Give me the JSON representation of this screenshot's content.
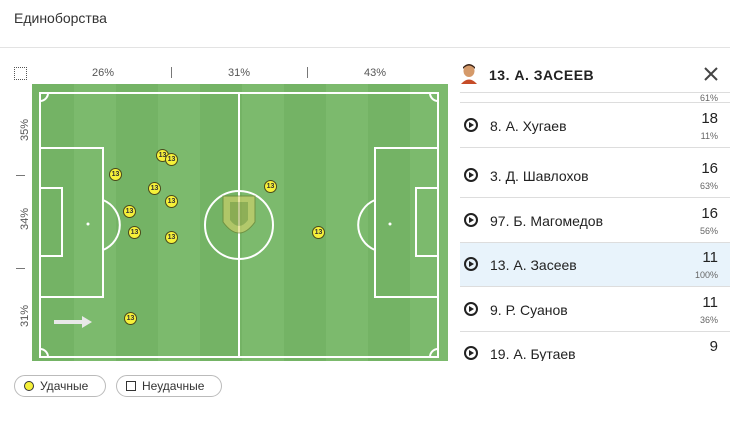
{
  "title": "Единоборства",
  "top_pcts": [
    "26%",
    "31%",
    "43%"
  ],
  "left_pcts": [
    "35%",
    "34%",
    "31%"
  ],
  "player_number": "13",
  "panel": {
    "player": "13. А. ЗАСЕЕВ",
    "partial_pct": "61%",
    "rows": [
      {
        "name": "8. А. Хугаев",
        "value": "18",
        "pct": "11%"
      },
      {
        "name": "3. Д. Шавлохов",
        "value": "16",
        "pct": "63%"
      },
      {
        "name": "97. Б. Магомедов",
        "value": "16",
        "pct": "56%"
      },
      {
        "name": "13. А. Засеев",
        "value": "11",
        "pct": "100%"
      },
      {
        "name": "9. Р. Суанов",
        "value": "11",
        "pct": "36%"
      },
      {
        "name": "19. А. Бутаев",
        "value": "9",
        "pct": ""
      }
    ]
  },
  "legend": {
    "success": "Удачные",
    "fail": "Неудачные"
  },
  "colors": {
    "pitch": "#7cba6d",
    "dot": "#f6f13a",
    "selected_row": "#e8f3fb"
  }
}
